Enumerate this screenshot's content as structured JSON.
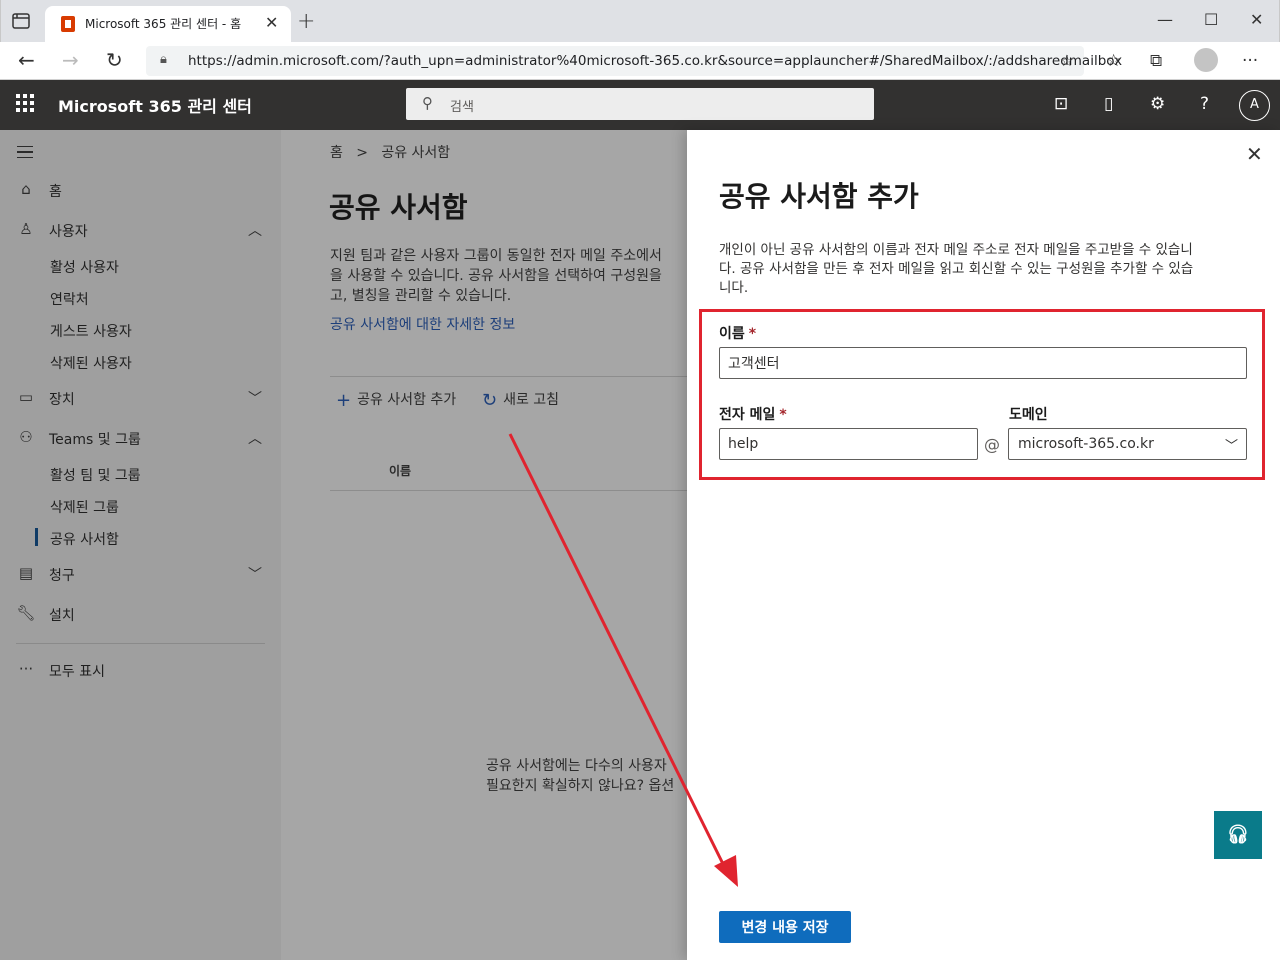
{
  "browser": {
    "tab_title": "Microsoft 365 관리 센터 - 홈",
    "url": "https://admin.microsoft.com/?auth_upn=administrator%40microsoft-365.co.kr&source=applauncher#/SharedMailbox/:/addsharedmailbox"
  },
  "header": {
    "app_name": "Microsoft 365 관리 센터",
    "search_placeholder": "검색",
    "avatar_initial": "A"
  },
  "sidebar": {
    "items": [
      {
        "label": "홈",
        "icon": "home-icon"
      },
      {
        "label": "사용자",
        "icon": "person-icon",
        "expanded": true
      },
      {
        "label": "장치",
        "icon": "device-icon",
        "expanded": false
      },
      {
        "label": "Teams 및 그룹",
        "icon": "people-icon",
        "expanded": true
      },
      {
        "label": "청구",
        "icon": "billing-icon",
        "expanded": false
      },
      {
        "label": "설치",
        "icon": "wrench-icon"
      },
      {
        "label": "모두 표시",
        "icon": "more-icon"
      }
    ],
    "user_subitems": [
      "활성 사용자",
      "연락처",
      "게스트 사용자",
      "삭제된 사용자"
    ],
    "teams_subitems": [
      "활성 팀 및 그룹",
      "삭제된 그룹",
      "공유 사서함"
    ]
  },
  "main": {
    "breadcrumb_home": "홈",
    "breadcrumb_current": "공유 사서함",
    "title": "공유 사서함",
    "description": "지원 팀과 같은 사용자 그룹이 동일한 전자 메일 주소에서\n을 사용할 수 있습니다. 공유 사서함을 선택하여 구성원을\n고, 별칭을 관리할 수 있습니다.",
    "learn_more": "공유 사서함에 대한 자세한 정보",
    "add_command": "공유 사서함 추가",
    "refresh_command": "새로 고침",
    "column_name": "이름",
    "empty_text": "공유 사서함에는 다수의 사용자\n필요한지 확실하지 않나요? 옵션"
  },
  "panel": {
    "title": "공유 사서함 추가",
    "description": "개인이 아닌 공유 사서함의 이름과 전자 메일 주소로 전자 메일을 주고받을 수 있습니\n다. 공유 사서함을 만든 후 전자 메일을 읽고 회신할 수 있는 구성원을 추가할 수 있습\n니다.",
    "name_label": "이름",
    "name_value": "고객센터",
    "email_label": "전자 메일",
    "email_value": "help",
    "at": "@",
    "domain_label": "도메인",
    "domain_value": "microsoft-365.co.kr",
    "required_mark": "*",
    "save_button": "변경 내용 저장"
  },
  "colors": {
    "accent": "#0f6cbd",
    "highlight": "#e0242f",
    "header_bg": "#323130"
  }
}
